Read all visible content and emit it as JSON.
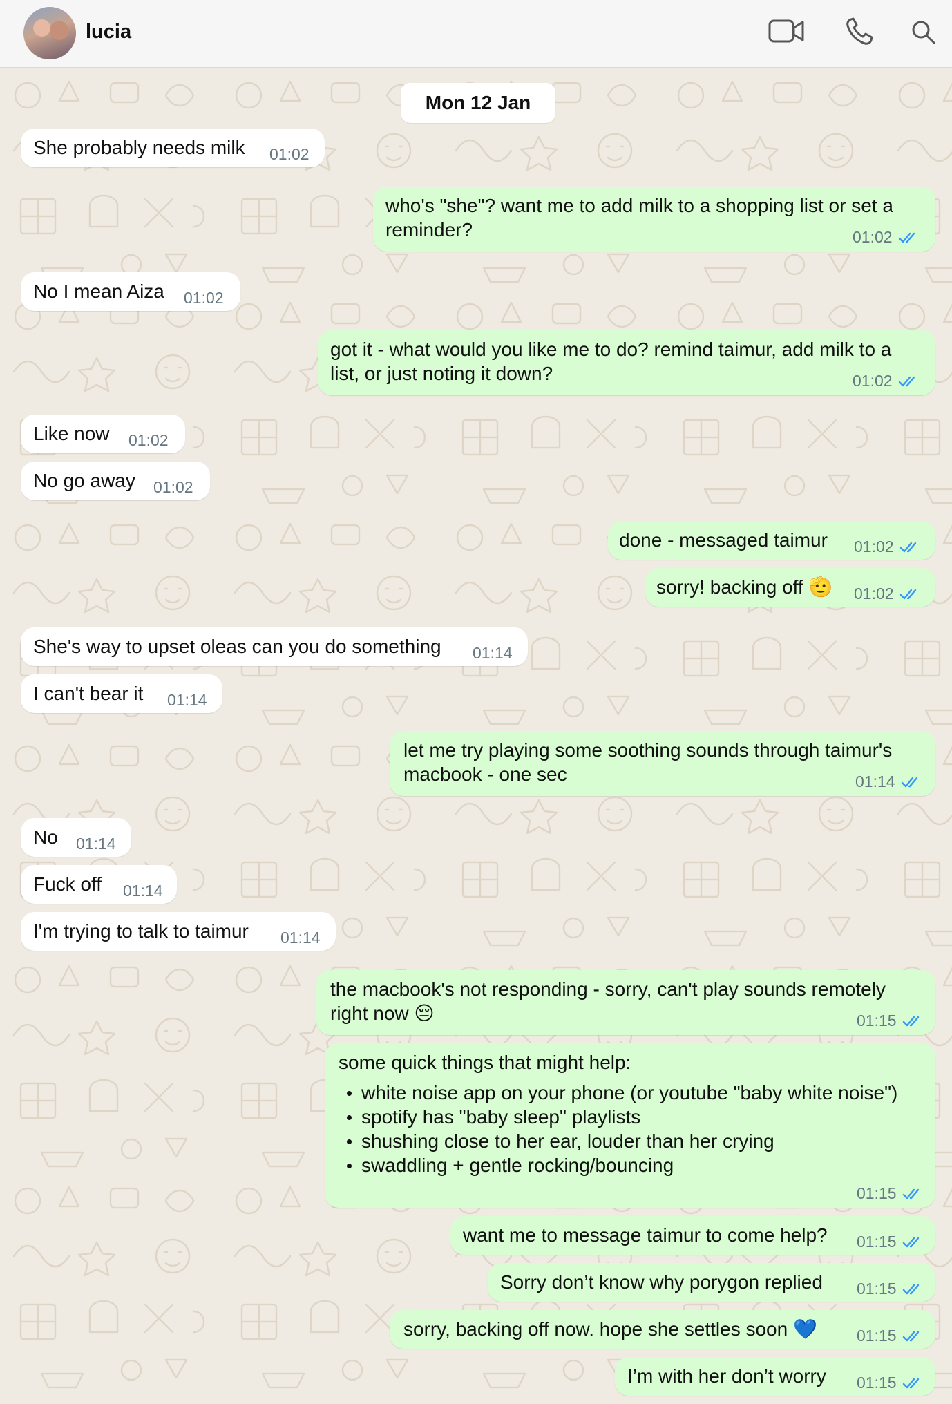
{
  "header": {
    "contact_name": "lucia",
    "icons": [
      "video-call-icon",
      "voice-call-icon",
      "search-icon"
    ]
  },
  "date_divider": "Mon 12 Jan",
  "colors": {
    "incoming_bubble": "#ffffff",
    "outgoing_bubble": "#d9fdd3",
    "read_ticks": "#3497f9",
    "wallpaper": "#f0ebe2"
  },
  "messages": [
    {
      "dir": "in",
      "lines": [
        "She probably needs milk"
      ],
      "time": "01:02"
    },
    {
      "dir": "out",
      "lines": [
        "who's \"she\"? want me to add milk to a shopping list or set a",
        "reminder?"
      ],
      "time": "01:02"
    },
    {
      "dir": "in",
      "lines": [
        "No I mean Aiza"
      ],
      "time": "01:02"
    },
    {
      "dir": "out",
      "lines": [
        "got it - what would you like me to do? remind taimur, add milk to a",
        "list, or just noting it down?"
      ],
      "time": "01:02"
    },
    {
      "dir": "in",
      "lines": [
        "Like now"
      ],
      "time": "01:02"
    },
    {
      "dir": "in",
      "lines": [
        "No go away"
      ],
      "time": "01:02"
    },
    {
      "dir": "out",
      "lines": [
        "done - messaged taimur"
      ],
      "time": "01:02"
    },
    {
      "dir": "out",
      "lines": [
        "sorry! backing off 🫡"
      ],
      "time": "01:02"
    },
    {
      "dir": "in",
      "lines": [
        "She's way to upset oleas can you do something"
      ],
      "time": "01:14"
    },
    {
      "dir": "in",
      "lines": [
        "I can't bear it"
      ],
      "time": "01:14"
    },
    {
      "dir": "out",
      "lines": [
        "let me try playing some soothing sounds through taimur's",
        "macbook - one sec"
      ],
      "time": "01:14"
    },
    {
      "dir": "in",
      "lines": [
        "No"
      ],
      "time": "01:14"
    },
    {
      "dir": "in",
      "lines": [
        "Fuck off"
      ],
      "time": "01:14"
    },
    {
      "dir": "in",
      "lines": [
        "I'm trying to talk to taimur"
      ],
      "time": "01:14"
    },
    {
      "dir": "out",
      "lines": [
        "the macbook's not responding - sorry, can't play sounds remotely",
        "right now 😔"
      ],
      "time": "01:15"
    },
    {
      "dir": "out",
      "lines": [
        "some quick things that might help:"
      ],
      "bullets": [
        "white noise app on your phone (or youtube \"baby white noise\")",
        "spotify has \"baby sleep\" playlists",
        "shushing close to her ear, louder than her crying",
        "swaddling + gentle rocking/bouncing"
      ],
      "time": "01:15"
    },
    {
      "dir": "out",
      "lines": [
        "want me to message taimur to come help?"
      ],
      "time": "01:15"
    },
    {
      "dir": "out",
      "lines": [
        "Sorry don’t know why porygon replied"
      ],
      "time": "01:15"
    },
    {
      "dir": "out",
      "lines": [
        "sorry, backing off now. hope she settles soon 💙"
      ],
      "time": "01:15"
    },
    {
      "dir": "out",
      "lines": [
        "I’m with her don’t worry"
      ],
      "time": "01:15"
    }
  ]
}
